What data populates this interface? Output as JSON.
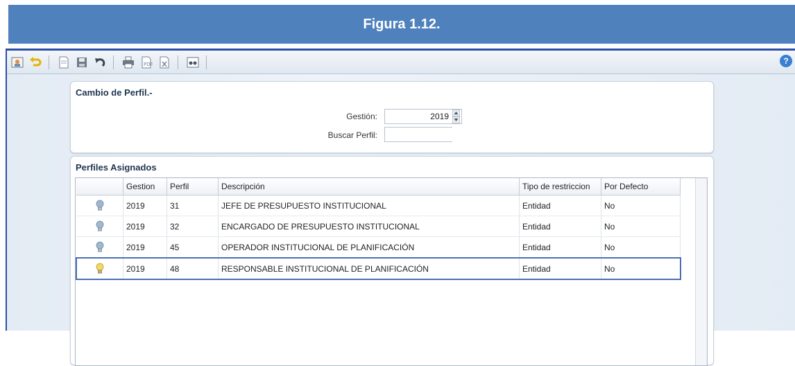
{
  "banner": {
    "title": "Figura 1.12."
  },
  "toolbar": {
    "icons": [
      "profile-icon",
      "back-icon",
      "new-document-icon",
      "save-icon",
      "undo-icon",
      "print-icon",
      "export-pdf-icon",
      "export-excel-icon",
      "preview-icon",
      "help-icon"
    ],
    "help_label": "?"
  },
  "cambio": {
    "title": "Cambio de Perfil.-",
    "gestion_label": "Gestión:",
    "gestion_value": "2019",
    "buscar_label": "Buscar Perfil:",
    "buscar_value": ""
  },
  "perfiles": {
    "title": "Perfiles Asignados",
    "columns": [
      "",
      "Gestion",
      "Perfil",
      "Descripción",
      "Tipo de restriccion",
      "Por Defecto"
    ],
    "rows": [
      {
        "gestion": "2019",
        "perfil": "31",
        "descripcion": "JEFE DE PRESUPUESTO INSTITUCIONAL",
        "tipo": "Entidad",
        "defecto": "No",
        "selected": false
      },
      {
        "gestion": "2019",
        "perfil": "32",
        "descripcion": "ENCARGADO DE PRESUPUESTO INSTITUCIONAL",
        "tipo": "Entidad",
        "defecto": "No",
        "selected": false
      },
      {
        "gestion": "2019",
        "perfil": "45",
        "descripcion": "OPERADOR INSTITUCIONAL DE PLANIFICACIÓN",
        "tipo": "Entidad",
        "defecto": "No",
        "selected": false
      },
      {
        "gestion": "2019",
        "perfil": "48",
        "descripcion": "RESPONSABLE INSTITUCIONAL DE PLANIFICACIÓN",
        "tipo": "Entidad",
        "defecto": "No",
        "selected": true
      }
    ]
  },
  "colors": {
    "banner": "#4f81bd",
    "frame": "#2b4fa3",
    "bulb_off": "#9fb8cf",
    "bulb_on": "#f2d96b",
    "selection": "#4a6fb5"
  }
}
